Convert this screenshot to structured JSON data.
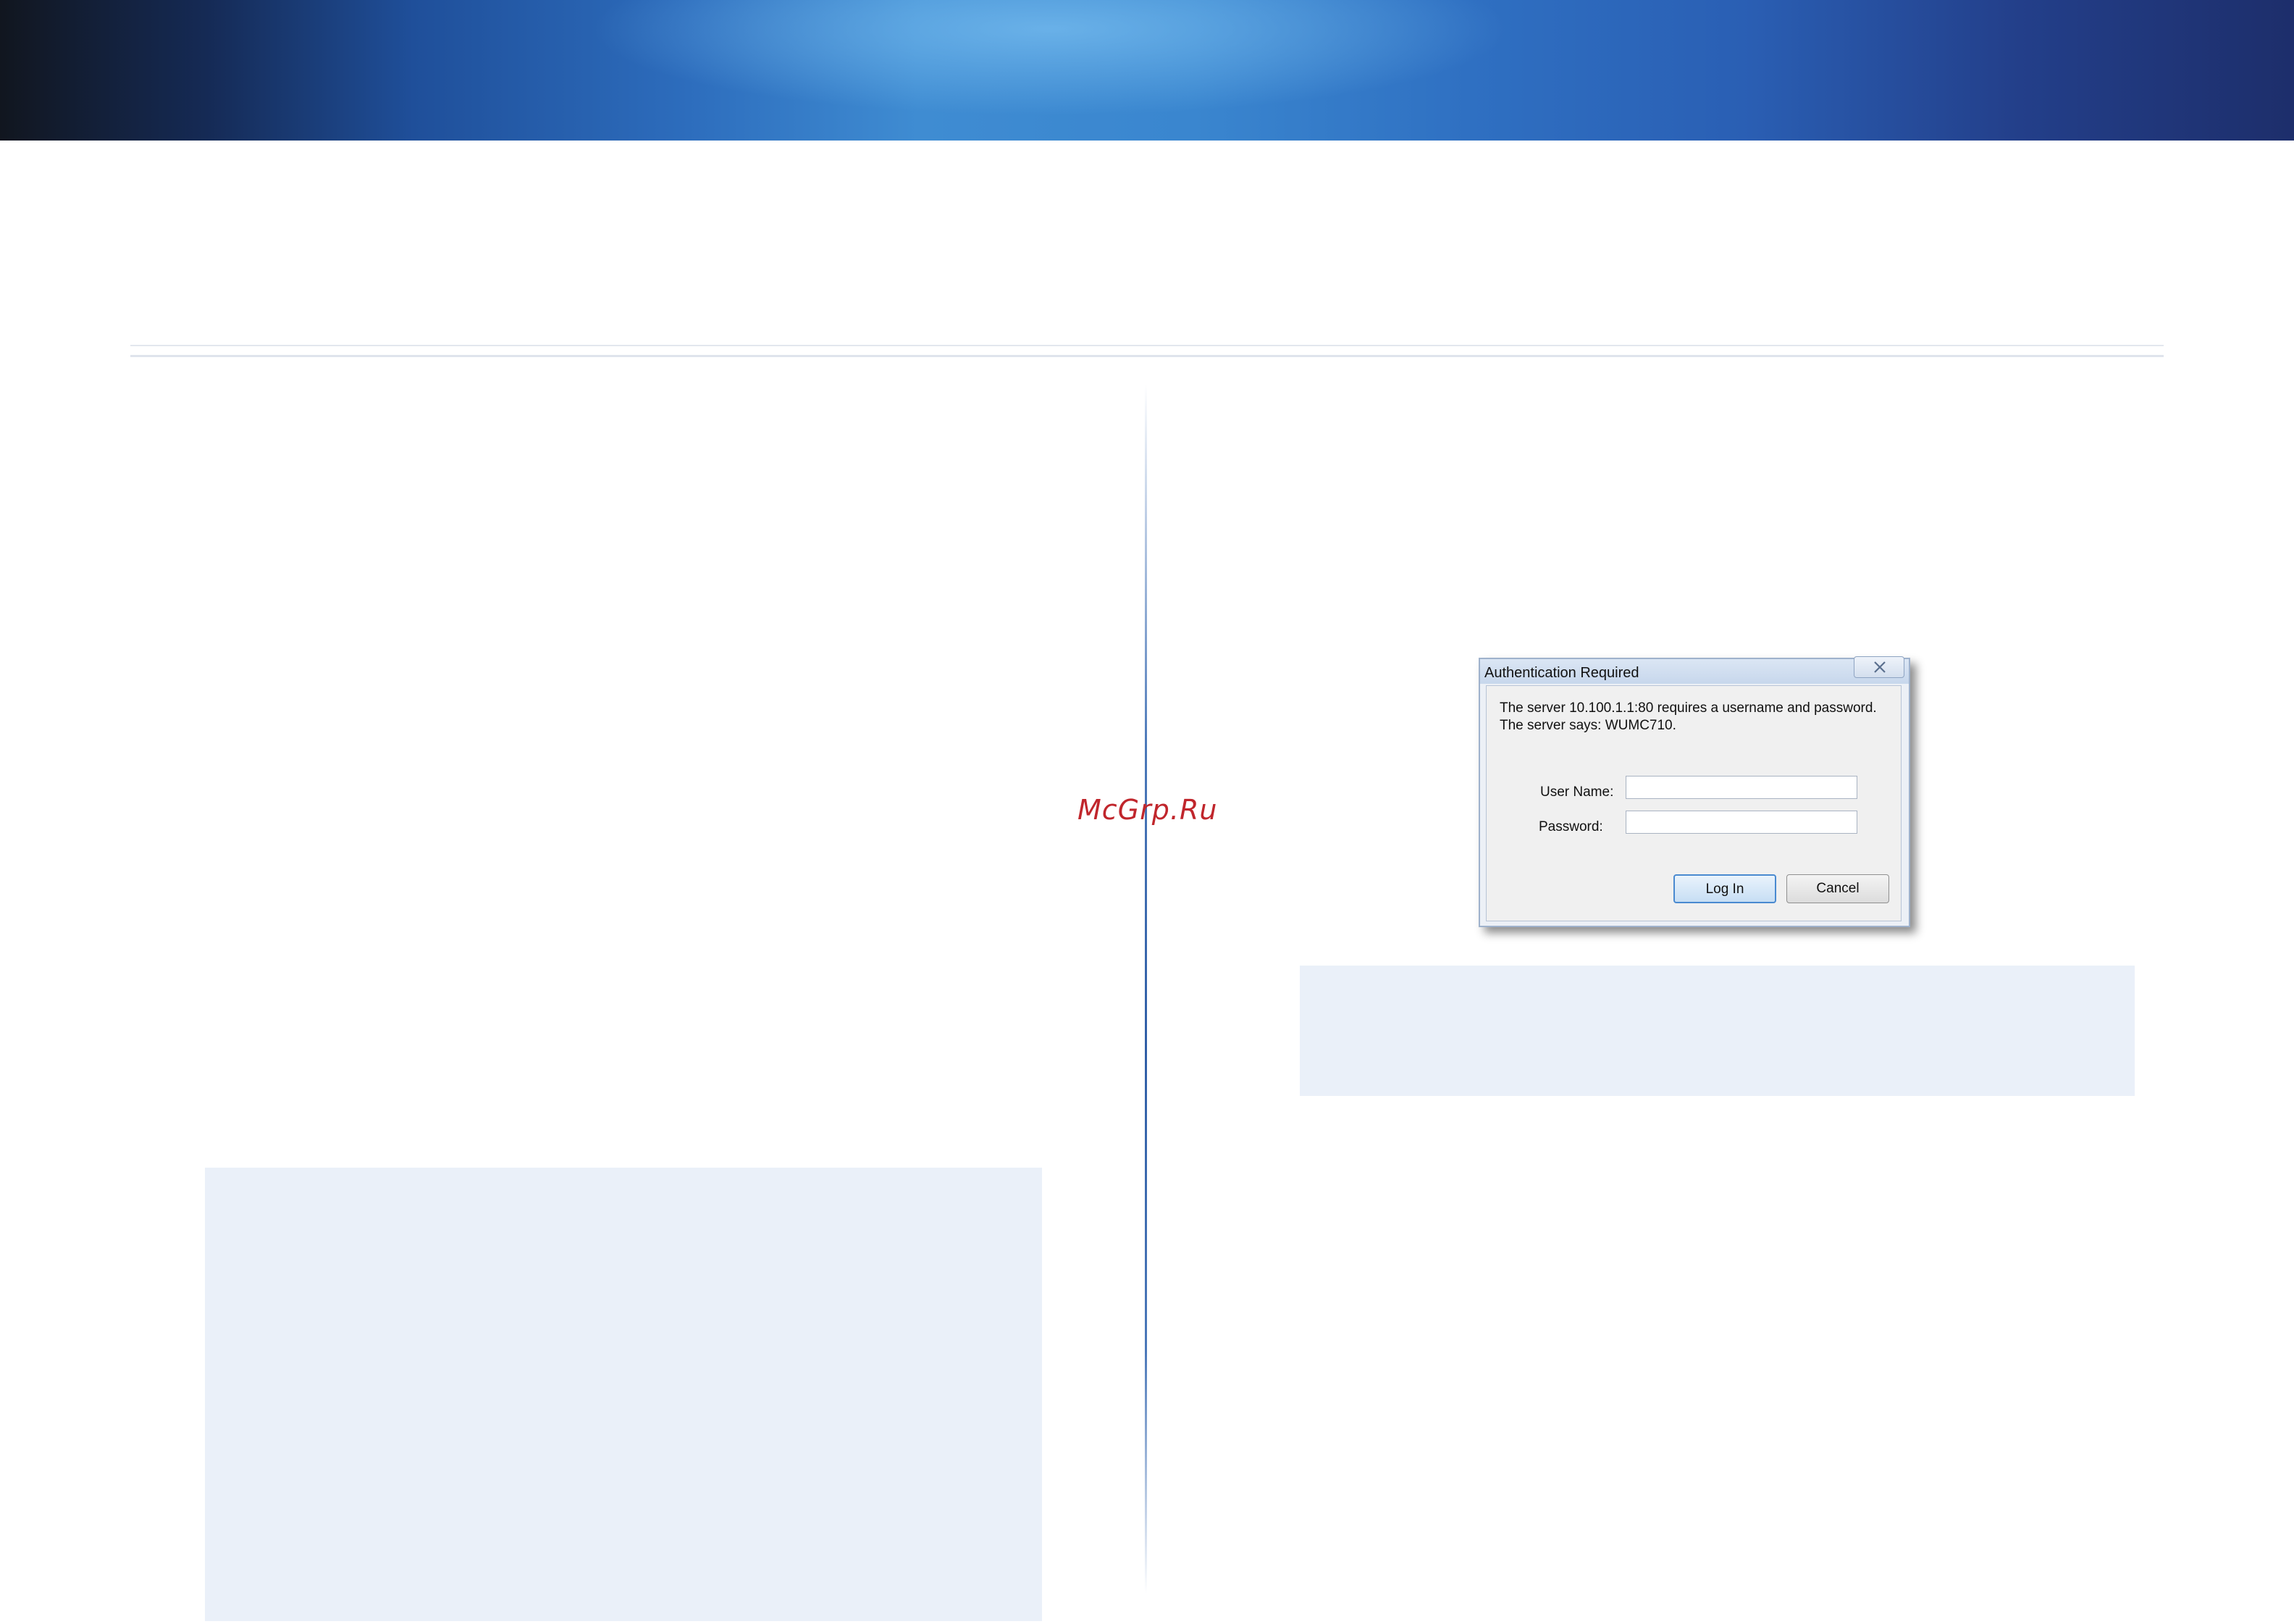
{
  "watermark": "McGrp.Ru",
  "dialog": {
    "title": "Authentication Required",
    "message_line1": "The server 10.100.1.1:80 requires a username and password.",
    "message_line2": "The server says: WUMC710.",
    "username_label": "User Name:",
    "password_label": "Password:",
    "username_value": "",
    "password_value": "",
    "login_button": "Log In",
    "cancel_button": "Cancel",
    "close_icon": "close-icon"
  },
  "colors": {
    "banner_dark": "#11161f",
    "banner_blue": "#3f8cd2",
    "note_box": "#eaf0f9",
    "divider": "#2f5ea6",
    "watermark": "#c0262c"
  }
}
